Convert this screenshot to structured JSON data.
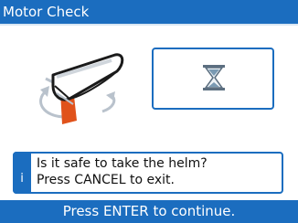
{
  "header": {
    "title": "Motor Check"
  },
  "graphics": {
    "boat_icon": "boat-steering-icon",
    "status_icon": "hourglass-icon"
  },
  "message": {
    "info_icon": "i",
    "line1": "Is it safe to take the helm?",
    "line2": "Press CANCEL to exit."
  },
  "footer": {
    "prompt": "Press ENTER to continue."
  },
  "colors": {
    "accent": "#1b6dbf",
    "rudder": "#e0521b",
    "hourglass_sand": "#7a9ab3"
  }
}
